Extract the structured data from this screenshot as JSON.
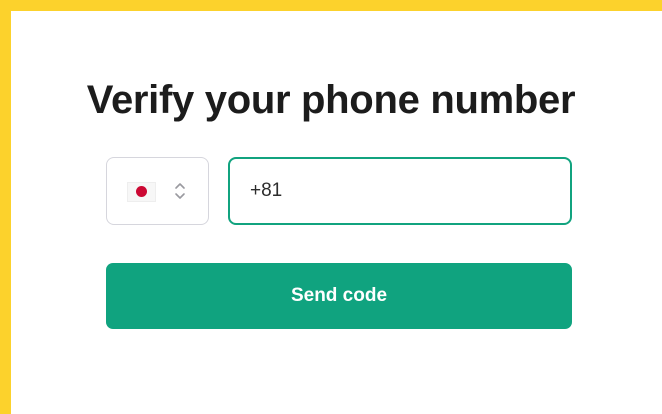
{
  "page": {
    "title": "Verify your phone number"
  },
  "country_selector": {
    "flag": "japan-flag-icon",
    "icon": "up-down-chevron-icon"
  },
  "phone_field": {
    "value": "+81"
  },
  "actions": {
    "send_label": "Send code"
  },
  "colors": {
    "frame": "#fcd22c",
    "accent": "#10a37f",
    "flag_red": "#cc0833",
    "title": "#1c1c1c"
  }
}
